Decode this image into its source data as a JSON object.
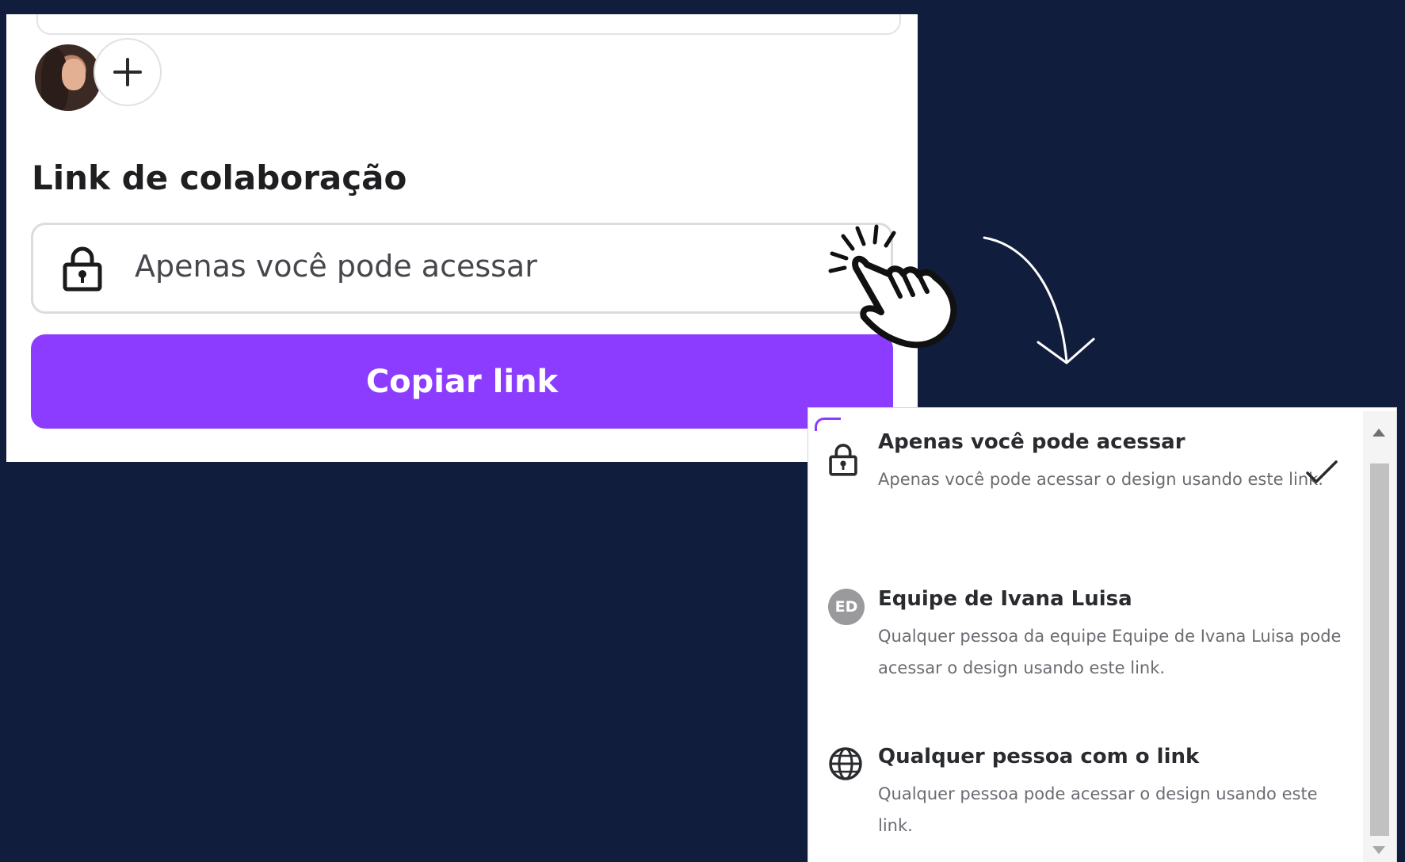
{
  "share_panel": {
    "add_collaborator_label": "+",
    "section_title": "Link de colaboração",
    "access_select_value": "Apenas você pode acessar",
    "copy_button_label": "Copiar link"
  },
  "access_options": [
    {
      "title": "Apenas você pode acessar",
      "description": "Apenas você pode acessar o design usando este link.",
      "icon": "lock-icon",
      "selected": true
    },
    {
      "title": "Equipe de Ivana Luisa",
      "description": "Qualquer pessoa da equipe Equipe de Ivana Luisa pode acessar o design usando este link.",
      "icon": "team-badge",
      "badge_text": "ED",
      "selected": false
    },
    {
      "title": "Qualquer pessoa com o link",
      "description": "Qualquer pessoa pode acessar o design usando este link.",
      "icon": "globe-icon",
      "selected": false
    }
  ],
  "colors": {
    "background": "#111d3d",
    "accent": "#8c3cff",
    "panel": "#ffffff"
  }
}
